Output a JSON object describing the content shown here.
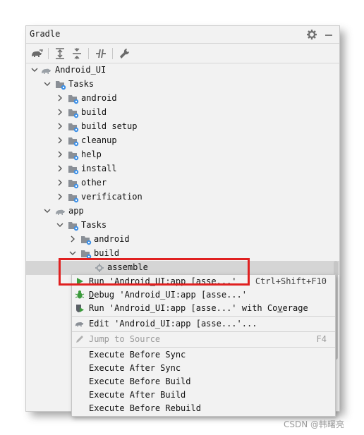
{
  "panel": {
    "title": "Gradle"
  },
  "tree": {
    "root": "Android_UI",
    "root_tasks": "Tasks",
    "root_task_groups": [
      "android",
      "build",
      "build setup",
      "cleanup",
      "help",
      "install",
      "other",
      "verification"
    ],
    "app": "app",
    "app_tasks": "Tasks",
    "app_android": "android",
    "app_build": "build",
    "selected_task": "assemble"
  },
  "context_menu": {
    "run_prefix": "R",
    "run_mnemonic": "u",
    "run_suffix": "n 'Android_UI:app [asse...'",
    "run_shortcut": "Ctrl+Shift+F10",
    "debug_mnemonic": "D",
    "debug_suffix": "ebug 'Android_UI:app [asse...'",
    "coverage_prefix": "Run 'Android_UI:app [asse...' with Co",
    "coverage_mnemonic": "v",
    "coverage_suffix": "erage",
    "edit_label": "Edit 'Android_UI:app [asse...'...",
    "jump_label": "Jump to Source",
    "jump_shortcut": "F4",
    "items": [
      "Execute Before Sync",
      "Execute After Sync",
      "Execute Before Build",
      "Execute After Build",
      "Execute Before Rebuild"
    ]
  },
  "watermark": "CSDN @韩曙亮",
  "colors": {
    "highlight_box": "#e02020",
    "run_icon": "#3c9a3c",
    "debug_icon": "#3c9a3c",
    "folder_icon": "#8a8f96",
    "gear_badge": "#3a8ee6"
  }
}
